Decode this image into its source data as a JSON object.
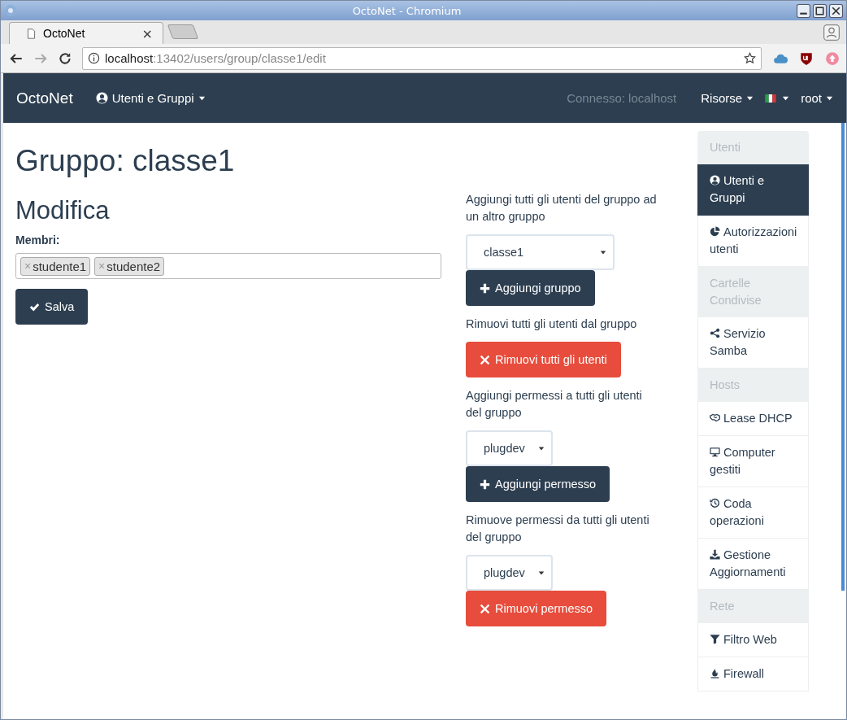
{
  "window": {
    "title": "OctoNet - Chromium"
  },
  "browser": {
    "tabs": [
      {
        "label": "OctoNet",
        "close": "×",
        "selected": true
      }
    ],
    "address": {
      "host": "localhost",
      "rest": ":13402/users/group/classe1/edit"
    }
  },
  "navbar": {
    "brand": "OctoNet",
    "menus": [
      {
        "kind": "user",
        "label": "Utenti e Gruppi"
      }
    ],
    "status": "Connesso: localhost",
    "right_menus": [
      {
        "kind": "text",
        "label": "Risorse"
      },
      {
        "kind": "flag"
      },
      {
        "kind": "text",
        "label": "root"
      }
    ]
  },
  "page": {
    "title": "Gruppo: classe1",
    "section": "Modifica",
    "members_label": "Membri:",
    "members": [
      {
        "remove": "×",
        "label": "studente1"
      },
      {
        "remove": "×",
        "label": "studente2"
      }
    ],
    "save_button": "Salva"
  },
  "actions": [
    {
      "kind": "text",
      "label": "Aggiungi tutti gli utenti del gruppo ad un altro gruppo"
    },
    {
      "kind": "group_select",
      "value": "classe1"
    },
    {
      "kind": "add_button",
      "label": "Aggiungi gruppo"
    },
    {
      "kind": "text",
      "label": "Rimuovi tutti gli utenti dal gruppo"
    },
    {
      "kind": "remove_button",
      "label": "Rimuovi tutti gli utenti"
    },
    {
      "kind": "text",
      "label": "Aggiungi permessi a tutti gli utenti del gruppo"
    },
    {
      "kind": "permission_select",
      "value": "plugdev"
    },
    {
      "kind": "add_button",
      "label": "Aggiungi permesso"
    },
    {
      "kind": "text",
      "label": "Rimuove permessi da tutti gli utenti del gruppo"
    },
    {
      "kind": "permission_select",
      "value": "plugdev"
    },
    {
      "kind": "remove_button",
      "label": "Rimuovi permesso"
    }
  ],
  "sidebar": {
    "items": [
      {
        "kind": "header",
        "label": "Utenti"
      },
      {
        "kind": "link",
        "label": "Utenti e Gruppi",
        "selected": true
      },
      {
        "kind": "link",
        "label": "Autorizzazioni utenti",
        "selected": false
      },
      {
        "kind": "header",
        "label": "Cartelle Condivise"
      },
      {
        "kind": "link",
        "label": "Servizio Samba",
        "selected": false
      },
      {
        "kind": "header",
        "label": "Hosts"
      },
      {
        "kind": "link",
        "label": "Lease DHCP",
        "selected": false
      },
      {
        "kind": "link",
        "label": "Computer gestiti",
        "selected": false
      },
      {
        "kind": "link",
        "label": "Coda operazioni",
        "selected": false
      },
      {
        "kind": "link",
        "label": "Gestione Aggiornamenti",
        "selected": false
      },
      {
        "kind": "header",
        "label": "Rete"
      },
      {
        "kind": "link",
        "label": "Filtro Web",
        "selected": false
      },
      {
        "kind": "link",
        "label": "Firewall",
        "selected": false
      }
    ]
  }
}
